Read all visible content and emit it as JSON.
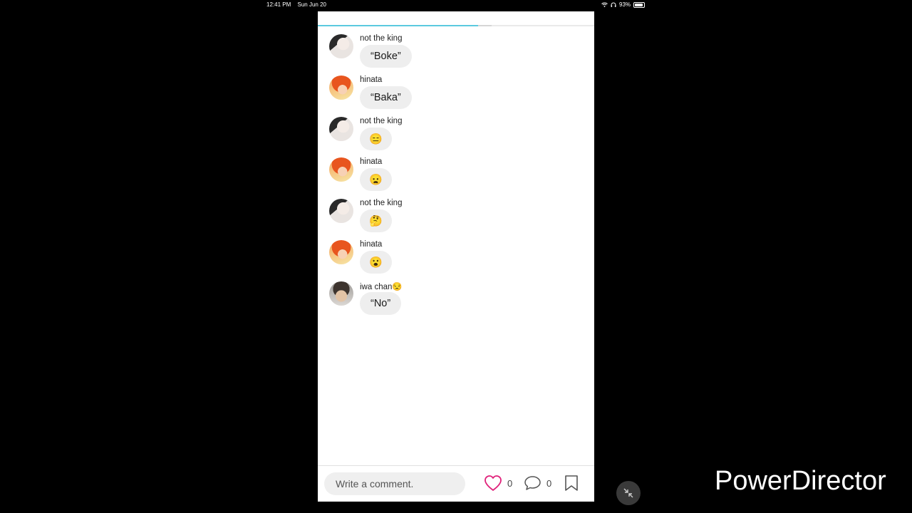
{
  "status_bar": {
    "time": "12:41 PM",
    "date": "Sun Jun 20",
    "battery": "93%"
  },
  "story": {
    "progress": 0.58,
    "buffered": 0.63
  },
  "messages": [
    {
      "author": "not the king",
      "text": "“Boke”",
      "avatar": "king"
    },
    {
      "author": "hinata",
      "text": "“Baka”",
      "avatar": "hinata"
    },
    {
      "author": "not the king",
      "text": "😑",
      "avatar": "king"
    },
    {
      "author": "hinata",
      "text": "😦",
      "avatar": "hinata"
    },
    {
      "author": "not the king",
      "text": "🤔",
      "avatar": "king"
    },
    {
      "author": "hinata",
      "text": "😮",
      "avatar": "hinata"
    },
    {
      "author": "iwa chan😒",
      "text": "“No”",
      "avatar": "iwa"
    }
  ],
  "footer": {
    "comment_placeholder": "Write a comment.",
    "likes_count": "0",
    "comments_count": "0",
    "like_icon": "heart-icon",
    "comment_icon": "speech-bubble-icon",
    "bookmark_icon": "bookmark-icon"
  },
  "colors": {
    "accent_progress": "#5bc9df",
    "like": "#e0207a"
  },
  "overlay": {
    "watermark": "PowerDirector"
  }
}
